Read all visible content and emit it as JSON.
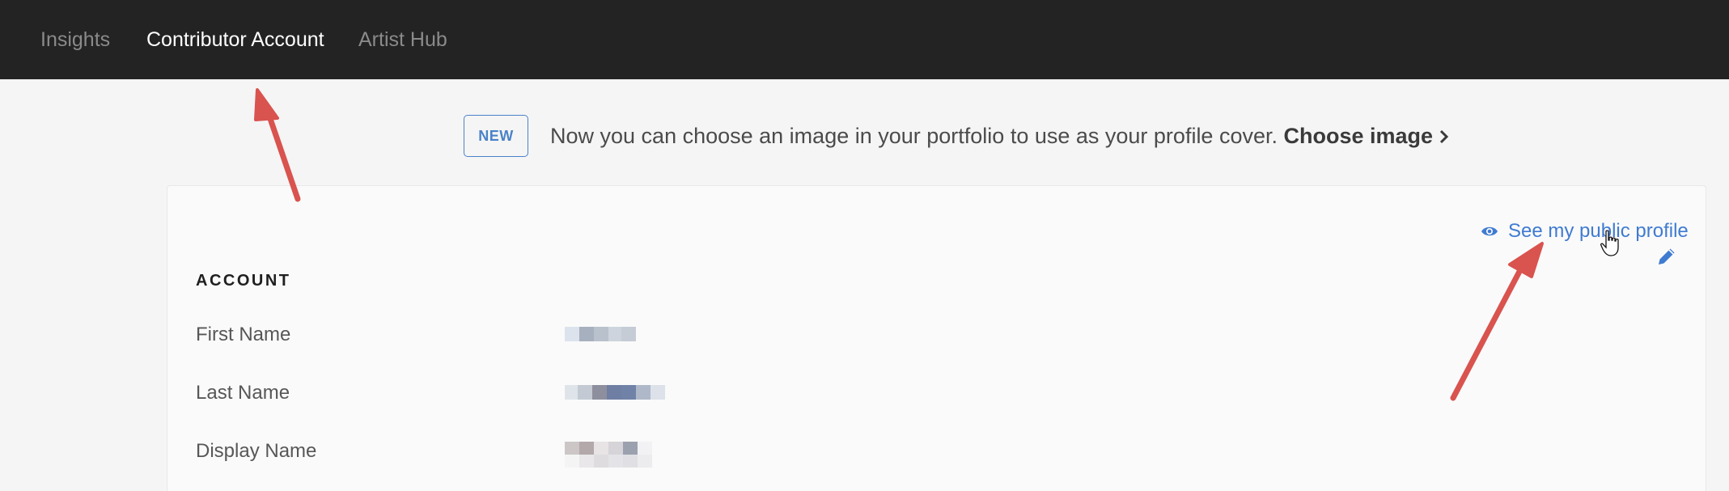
{
  "nav": {
    "items": [
      {
        "label": "Insights",
        "active": false
      },
      {
        "label": "Contributor Account",
        "active": true
      },
      {
        "label": "Artist Hub",
        "active": false
      }
    ]
  },
  "banner": {
    "badge": "NEW",
    "text": "Now you can choose an image in your portfolio to use as your profile cover. ",
    "link_label": "Choose image",
    "link_icon": "chevron-right-icon"
  },
  "profile_link": {
    "label": "See my public profile",
    "icon": "eye-icon"
  },
  "edit": {
    "icon": "pencil-icon"
  },
  "account": {
    "title": "ACCOUNT",
    "fields": [
      {
        "label": "First Name"
      },
      {
        "label": "Last Name"
      },
      {
        "label": "Display Name"
      }
    ]
  },
  "colors": {
    "nav_bg": "#232323",
    "accent": "#3f7bd1",
    "annotation_arrow": "#d9534f"
  }
}
